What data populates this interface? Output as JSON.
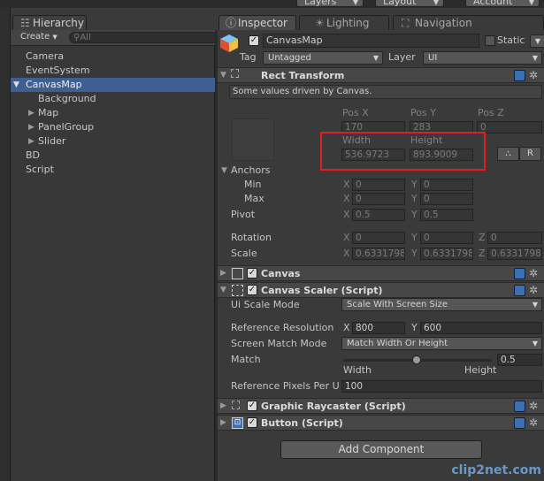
{
  "toolbar": {
    "layers": "Layers",
    "layout": "Layout",
    "account": "Account"
  },
  "hierarchy": {
    "tab_label": "Hierarchy",
    "create_label": "Create",
    "search_placeholder": "All",
    "items": [
      {
        "label": "Camera"
      },
      {
        "label": "EventSystem"
      },
      {
        "label": "CanvasMap"
      },
      {
        "label": "Background"
      },
      {
        "label": "Map"
      },
      {
        "label": "PanelGroup"
      },
      {
        "label": "Slider"
      },
      {
        "label": "BD"
      },
      {
        "label": "Script"
      }
    ]
  },
  "tabs": {
    "inspector": "Inspector",
    "lighting": "Lighting",
    "navigation": "Navigation"
  },
  "object": {
    "name": "CanvasMap",
    "static_label": "Static",
    "tag_label": "Tag",
    "tag_value": "Untagged",
    "layer_label": "Layer",
    "layer_value": "UI"
  },
  "rect_transform": {
    "title": "Rect Transform",
    "note": "Some values driven by Canvas.",
    "pos_x_label": "Pos X",
    "pos_y_label": "Pos Y",
    "pos_z_label": "Pos Z",
    "pos_x": "170",
    "pos_y": "283",
    "pos_z": "0",
    "width_label": "Width",
    "height_label": "Height",
    "width": "536.9723",
    "height": "893.9009",
    "r_button": "R",
    "anchors_label": "Anchors",
    "min_label": "Min",
    "max_label": "Max",
    "min_x": "0",
    "min_y": "0",
    "max_x": "0",
    "max_y": "0",
    "pivot_label": "Pivot",
    "pivot_x": "0.5",
    "pivot_y": "0.5",
    "rotation_label": "Rotation",
    "rot_x": "0",
    "rot_y": "0",
    "rot_z": "0",
    "scale_label": "Scale",
    "scale_x": "0.6331798",
    "scale_y": "0.6331798",
    "scale_z": "0.6331798",
    "x": "X",
    "y": "Y",
    "z": "Z"
  },
  "canvas": {
    "title": "Canvas"
  },
  "canvas_scaler": {
    "title": "Canvas Scaler (Script)",
    "ui_scale_mode_label": "Ui Scale Mode",
    "ui_scale_mode_value": "Scale With Screen Size",
    "ref_res_label": "Reference Resolution",
    "ref_x": "800",
    "ref_y": "600",
    "screen_match_label": "Screen Match Mode",
    "screen_match_value": "Match Width Or Height",
    "match_label": "Match",
    "match_value": "0.5",
    "match_fraction": 0.5,
    "width_label": "Width",
    "height_label": "Height",
    "ppu_label": "Reference Pixels Per U",
    "ppu_value": "100"
  },
  "graphic_raycaster": {
    "title": "Graphic Raycaster (Script)"
  },
  "button_script": {
    "title": "Button (Script)"
  },
  "add_component": "Add Component",
  "watermark": "clip2net.com",
  "colors": {
    "selection": "#3f5f93",
    "highlight_box": "#e02020",
    "component_icon": "#3d6fb4"
  },
  "icons": [
    "search-icon",
    "cube-icon",
    "rect-transform-icon",
    "canvas-icon",
    "canvas-scaler-icon",
    "graphic-raycaster-icon",
    "button-script-icon",
    "help-icon",
    "gear-icon",
    "inspector-icon",
    "lighting-icon",
    "navigation-icon"
  ]
}
